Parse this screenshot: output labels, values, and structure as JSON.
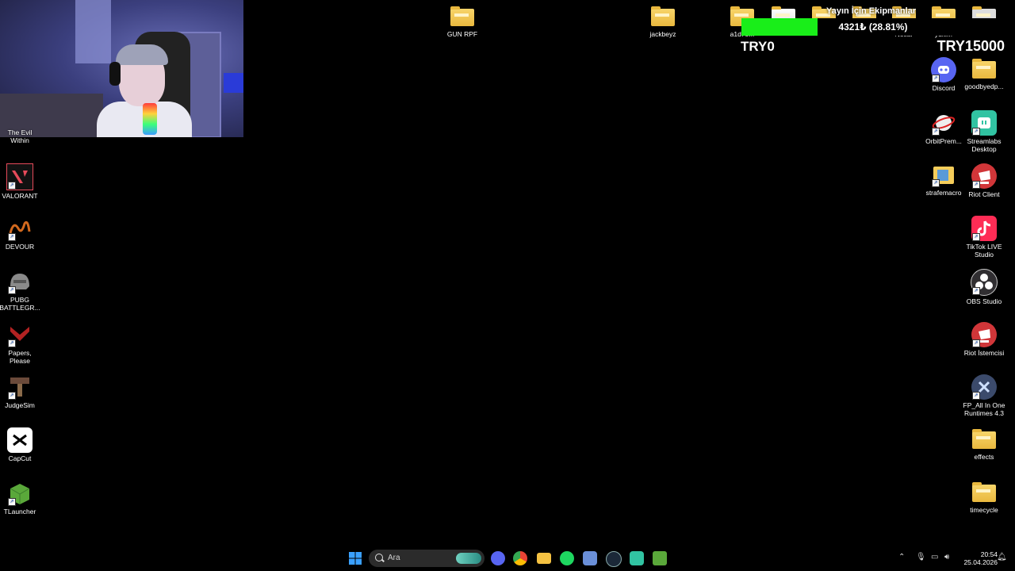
{
  "desktop": {
    "top_icons": [
      {
        "label": "GUN RPF",
        "kind": "folder"
      },
      {
        "label": "jackbeyz",
        "kind": "folder"
      },
      {
        "label": "a1d78...",
        "kind": "folder"
      }
    ],
    "left_icons": [
      {
        "label": "The Evil Within",
        "icon": "evil-within-icon",
        "color": "#5a3a2a"
      },
      {
        "label": "VALORANT",
        "icon": "valorant-icon",
        "color": "#e64a5a"
      },
      {
        "label": "DEVOUR",
        "icon": "devour-icon",
        "color": "#d2691e"
      },
      {
        "label": "PUBG BATTLEGR...",
        "icon": "pubg-icon",
        "color": "#8a8a8a"
      },
      {
        "label": "Papers, Please",
        "icon": "papers-please-icon",
        "color": "#b22222"
      },
      {
        "label": "JudgeSim",
        "icon": "judgesim-icon",
        "color": "#6b4a3a"
      },
      {
        "label": "CapCut",
        "icon": "capcut-icon",
        "color": "#ffffff"
      },
      {
        "label": "TLauncher",
        "icon": "tlauncher-icon",
        "color": "#5aa83a"
      }
    ],
    "right_col1": [
      {
        "label": "Notlar",
        "icon": "folder-icon"
      },
      {
        "label": "Discord",
        "icon": "discord-icon",
        "color": "#5865f2"
      },
      {
        "label": "OrbitPrem...",
        "icon": "orbit-icon",
        "color": "#cccccc"
      },
      {
        "label": "strafemacro",
        "icon": "folder-icon"
      }
    ],
    "right_col2": [
      {
        "label": "yükl...",
        "icon": "folder-icon"
      },
      {
        "label": "goodbyedp...",
        "icon": "folder-icon"
      },
      {
        "label": "Streamlabs Desktop",
        "icon": "streamlabs-icon",
        "color": "#31c3a2"
      },
      {
        "label": "Riot Client",
        "icon": "riot-client-icon",
        "color": "#d13639"
      },
      {
        "label": "TikTok LIVE Studio",
        "icon": "tiktok-icon",
        "color": "#fe2c55"
      },
      {
        "label": "OBS Studio",
        "icon": "obs-icon",
        "color": "#302e31"
      },
      {
        "label": "Riot İstemcisi",
        "icon": "riot-client-icon",
        "color": "#d13639"
      },
      {
        "label": "FP_All In One Runtimes 4.3",
        "icon": "runtimes-icon",
        "color": "#3b4a6b"
      },
      {
        "label": "effects",
        "icon": "folder-icon"
      },
      {
        "label": "timecycle",
        "icon": "folder-icon"
      }
    ]
  },
  "donation_goal": {
    "title": "Yayın İçin Ekipmanlar",
    "amount_text": "4321₺ (28.81%)",
    "progress": 0.2881,
    "start_label": "TRY0",
    "goal_label": "TRY15000",
    "bar_color": "#19ee19"
  },
  "taskbar": {
    "search_placeholder": "Ara",
    "pinned": [
      {
        "icon": "start-icon",
        "color": "#3aa0ff"
      },
      {
        "icon": "discord-icon",
        "color": "#5865f2"
      },
      {
        "icon": "chrome-icon",
        "color": "#ea4335"
      },
      {
        "icon": "file-explorer-icon",
        "color": "#f5c242"
      },
      {
        "icon": "spotify-icon",
        "color": "#1ed760"
      },
      {
        "icon": "app-icon",
        "color": "#6a8fd8"
      },
      {
        "icon": "steam-icon",
        "color": "#1b2838"
      },
      {
        "icon": "streamlabs-icon",
        "color": "#31c3a2"
      },
      {
        "icon": "minecraft-icon",
        "color": "#5aa83a"
      }
    ],
    "clock_time": "20:54",
    "clock_date": "25.04.2026"
  }
}
